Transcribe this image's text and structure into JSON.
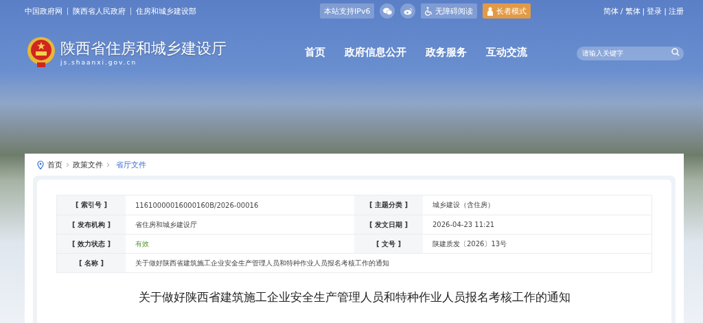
{
  "top_links": [
    "中国政府网",
    "陕西省人民政府",
    "住房和城乡建设部"
  ],
  "tools": [
    {
      "kind": "text",
      "label": "本站支持IPv6"
    },
    {
      "kind": "wechat"
    },
    {
      "kind": "weibo"
    },
    {
      "kind": "accessibility",
      "label": "无障碍阅读"
    },
    {
      "kind": "elder",
      "label": "长者模式"
    }
  ],
  "account_links": [
    {
      "label": "简体"
    },
    {
      "separator": "/",
      "label": "繁体"
    },
    {
      "separator": "|",
      "label": "登录"
    },
    {
      "separator": "|",
      "label": "注册"
    }
  ],
  "site": {
    "name": "陕西省住房和城乡建设厅",
    "domain": "js.shaanxi.gov.cn"
  },
  "nav": [
    "首页",
    "政府信息公开",
    "政务服务",
    "互动交流"
  ],
  "search": {
    "placeholder": "请输入关键字"
  },
  "breadcrumb": [
    {
      "label": "首页",
      "current": false
    },
    {
      "label": "政策文件",
      "current": false
    },
    {
      "label": "省厅文件",
      "current": true
    }
  ],
  "meta_rows": [
    {
      "cells": [
        {
          "label": "[ 索引号 ]",
          "value": "11610000016000160B/2026-00016"
        },
        {
          "label": "[ 主题分类 ]",
          "value": "城乡建设（含住房）"
        }
      ]
    },
    {
      "cells": [
        {
          "label": "[ 发布机构 ]",
          "value": "省住房和城乡建设厅"
        },
        {
          "label": "[ 发文日期 ]",
          "value": "2026-04-23 11:21"
        }
      ]
    },
    {
      "cells": [
        {
          "label": "[ 效力状态 ]",
          "value": "有效",
          "kind": "status"
        },
        {
          "label": "[ 文号 ]",
          "value": "陕建质发〔2026〕13号"
        }
      ]
    },
    {
      "cells": [
        {
          "label": "[ 名称 ]",
          "value": "关于做好陕西省建筑施工企业安全生产管理人员和特种作业人员报名考核工作的通知"
        }
      ]
    }
  ],
  "title": "关于做好陕西省建筑施工企业安全生产管理人员和特种作业人员报名考核工作的通知"
}
